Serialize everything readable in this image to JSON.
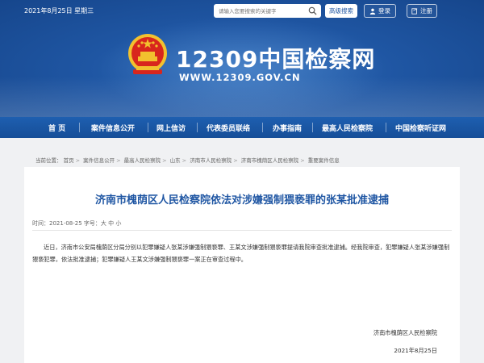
{
  "topbar": {
    "date": "2021年8月25日 星期三",
    "search_placeholder": "请输入您要搜索的关键字",
    "advanced_search": "高级搜索",
    "login": "登录",
    "register": "注册"
  },
  "logo": {
    "title": "12309中国检察网",
    "url": "WWW.12309.GOV.CN"
  },
  "nav": {
    "items": [
      "首 页",
      "案件信息公开",
      "网上信访",
      "代表委员联络",
      "办事指南",
      "最高人民检察院",
      "中国检察听证网"
    ]
  },
  "breadcrumb": {
    "label": "当前位置：",
    "items": [
      "首页",
      "案件信息公开",
      "最高人民检察院",
      "山东",
      "济南市人民检察院",
      "济南市槐荫区人民检察院",
      "重要案件信息"
    ]
  },
  "article": {
    "title": "济南市槐荫区人民检察院依法对涉嫌强制猥亵罪的张某批准逮捕",
    "meta": "时间：2021-08-25        字号：大  中  小",
    "body": "近日，济南市公安局槐荫区分局分别以犯罪嫌疑人张某涉嫌强制猥亵罪、王某文涉嫌强制猥亵罪提请我院审查批准逮捕。经我院审查，犯罪嫌疑人张某涉嫌强制猥亵犯罪，依法批准逮捕；犯罪嫌疑人王某文涉嫌强制猥亵罪一案正在审查过程中。",
    "signature_org": "济南市槐荫区人民检察院",
    "signature_date": "2021年8月25日"
  },
  "colors": {
    "brand_blue": "#1f56a3",
    "nav_blue": "#1a57a6",
    "emblem_red": "#d8261d",
    "emblem_gold": "#f2c12e"
  }
}
